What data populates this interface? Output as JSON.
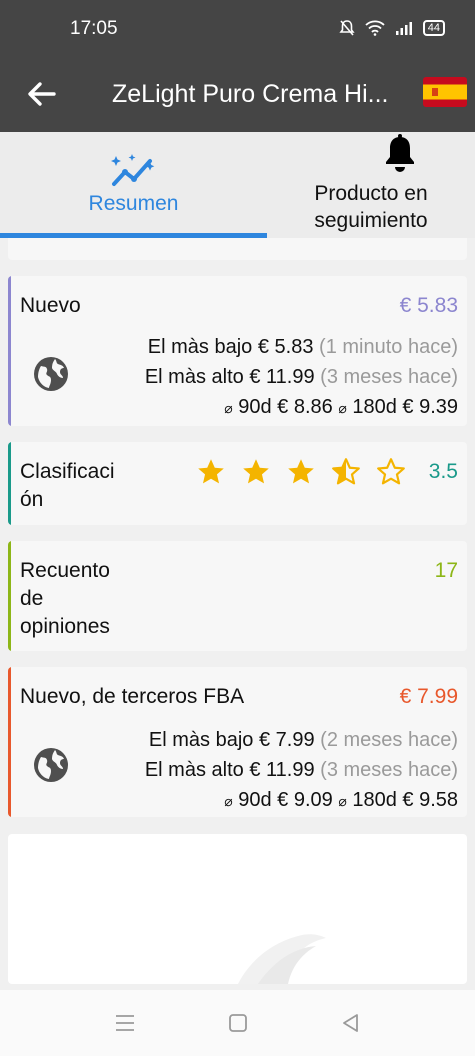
{
  "status": {
    "time": "17:05",
    "battery": "44"
  },
  "appbar": {
    "title": "ZeLight Puro Crema Hi..."
  },
  "tabs": [
    {
      "label": "Resumen"
    },
    {
      "label": "Producto en seguimiento"
    }
  ],
  "cards": {
    "nuevo": {
      "title": "Nuevo",
      "value": "€ 5.83",
      "low_label": "El màs bajo",
      "low_value": "€ 5.83",
      "low_ago": "(1 minuto hace)",
      "high_label": "El màs alto",
      "high_value": "€ 11.99",
      "high_ago": "(3 meses hace)",
      "avg_symbol": "⌀",
      "d90_label": "90d",
      "d90_value": "€ 8.86",
      "d180_label": "180d",
      "d180_value": "€ 9.39"
    },
    "rating": {
      "title_l1": "Clasificaci",
      "title_l2": "ón",
      "value": "3.5",
      "stars": 3.5
    },
    "reviews": {
      "l1": "Recuento",
      "l2": "de",
      "l3": "opiniones",
      "value": "17"
    },
    "fba": {
      "title": "Nuevo, de terceros FBA",
      "value": "€ 7.99",
      "low_label": "El màs bajo",
      "low_value": "€ 7.99",
      "low_ago": "(2 meses hace)",
      "high_label": "El màs alto",
      "high_value": "€ 11.99",
      "high_ago": "(3 meses hace)",
      "avg_symbol": "⌀",
      "d90_label": "90d",
      "d90_value": "€ 9.09",
      "d180_label": "180d",
      "d180_value": "€ 9.58"
    }
  },
  "colors": {
    "nuevo": "#8c86cf",
    "rating": "#1a9a8a",
    "reviews": "#8db617",
    "fba": "#e8582c",
    "accent": "#2e86de",
    "star": "#f4b400"
  }
}
